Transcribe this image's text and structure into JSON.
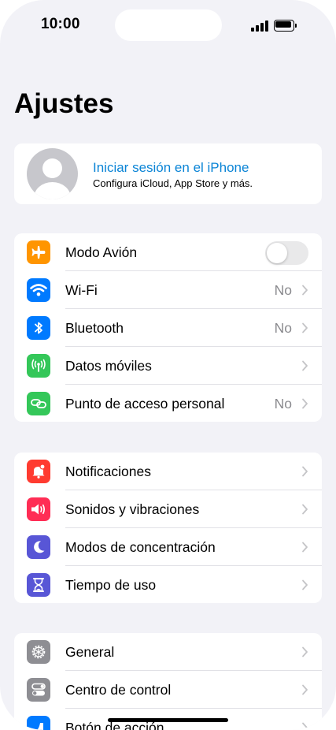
{
  "status_bar": {
    "time": "10:00"
  },
  "page_title": "Ajustes",
  "account": {
    "title": "Iniciar sesión en el iPhone",
    "subtitle": "Configura iCloud, App Store y más."
  },
  "group1": [
    {
      "label": "Modo Avión",
      "icon": "airplane-icon",
      "color": "#ff9500",
      "control": "toggle",
      "on": false
    },
    {
      "label": "Wi-Fi",
      "icon": "wifi-icon",
      "color": "#007aff",
      "value": "No"
    },
    {
      "label": "Bluetooth",
      "icon": "bluetooth-icon",
      "color": "#007aff",
      "value": "No"
    },
    {
      "label": "Datos móviles",
      "icon": "antenna-icon",
      "color": "#34c759",
      "value": ""
    },
    {
      "label": "Punto de acceso personal",
      "icon": "hotspot-link-icon",
      "color": "#34c759",
      "value": "No"
    }
  ],
  "group2": [
    {
      "label": "Notificaciones",
      "icon": "notification-bell-icon",
      "color": "#ff3b30"
    },
    {
      "label": "Sonidos y vibraciones",
      "icon": "speaker-icon",
      "color": "#ff2d55"
    },
    {
      "label": "Modos de concentración",
      "icon": "moon-icon",
      "color": "#5856d6"
    },
    {
      "label": "Tiempo de uso",
      "icon": "hourglass-icon",
      "color": "#5856d6"
    }
  ],
  "group3": [
    {
      "label": "General",
      "icon": "gear-icon",
      "color": "#8e8e93"
    },
    {
      "label": "Centro de control",
      "icon": "switches-icon",
      "color": "#8e8e93"
    },
    {
      "label": "Botón de acción",
      "icon": "action-button-icon",
      "color": "#007aff"
    }
  ]
}
